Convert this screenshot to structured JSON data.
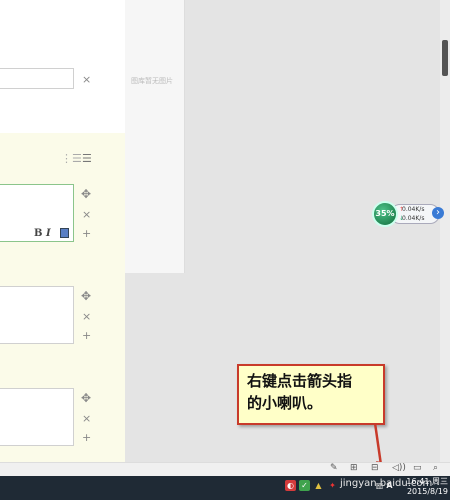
{
  "middle_panel": {
    "empty_text": "图库暂无图片"
  },
  "editor": {
    "format_buttons": {
      "bold": "B",
      "italic": "I"
    },
    "controls": {
      "move": "✥",
      "delete": "×",
      "add": "+"
    }
  },
  "network_widget": {
    "percent": "35%",
    "upload": "0.04K/s",
    "download": "0.04K/s"
  },
  "callout": {
    "line1": "右键点击箭头指",
    "line2": "的小喇叭。"
  },
  "taskbar": {
    "watermark": "jingyan.baidu.com",
    "time": "16:41",
    "weekday": "周三",
    "date": "2015/8/19",
    "tray_language": "A"
  },
  "colors": {
    "callout_border": "#c83a2a",
    "callout_fill": "#ffffc8",
    "panel_yellow": "#fbfbe9"
  }
}
